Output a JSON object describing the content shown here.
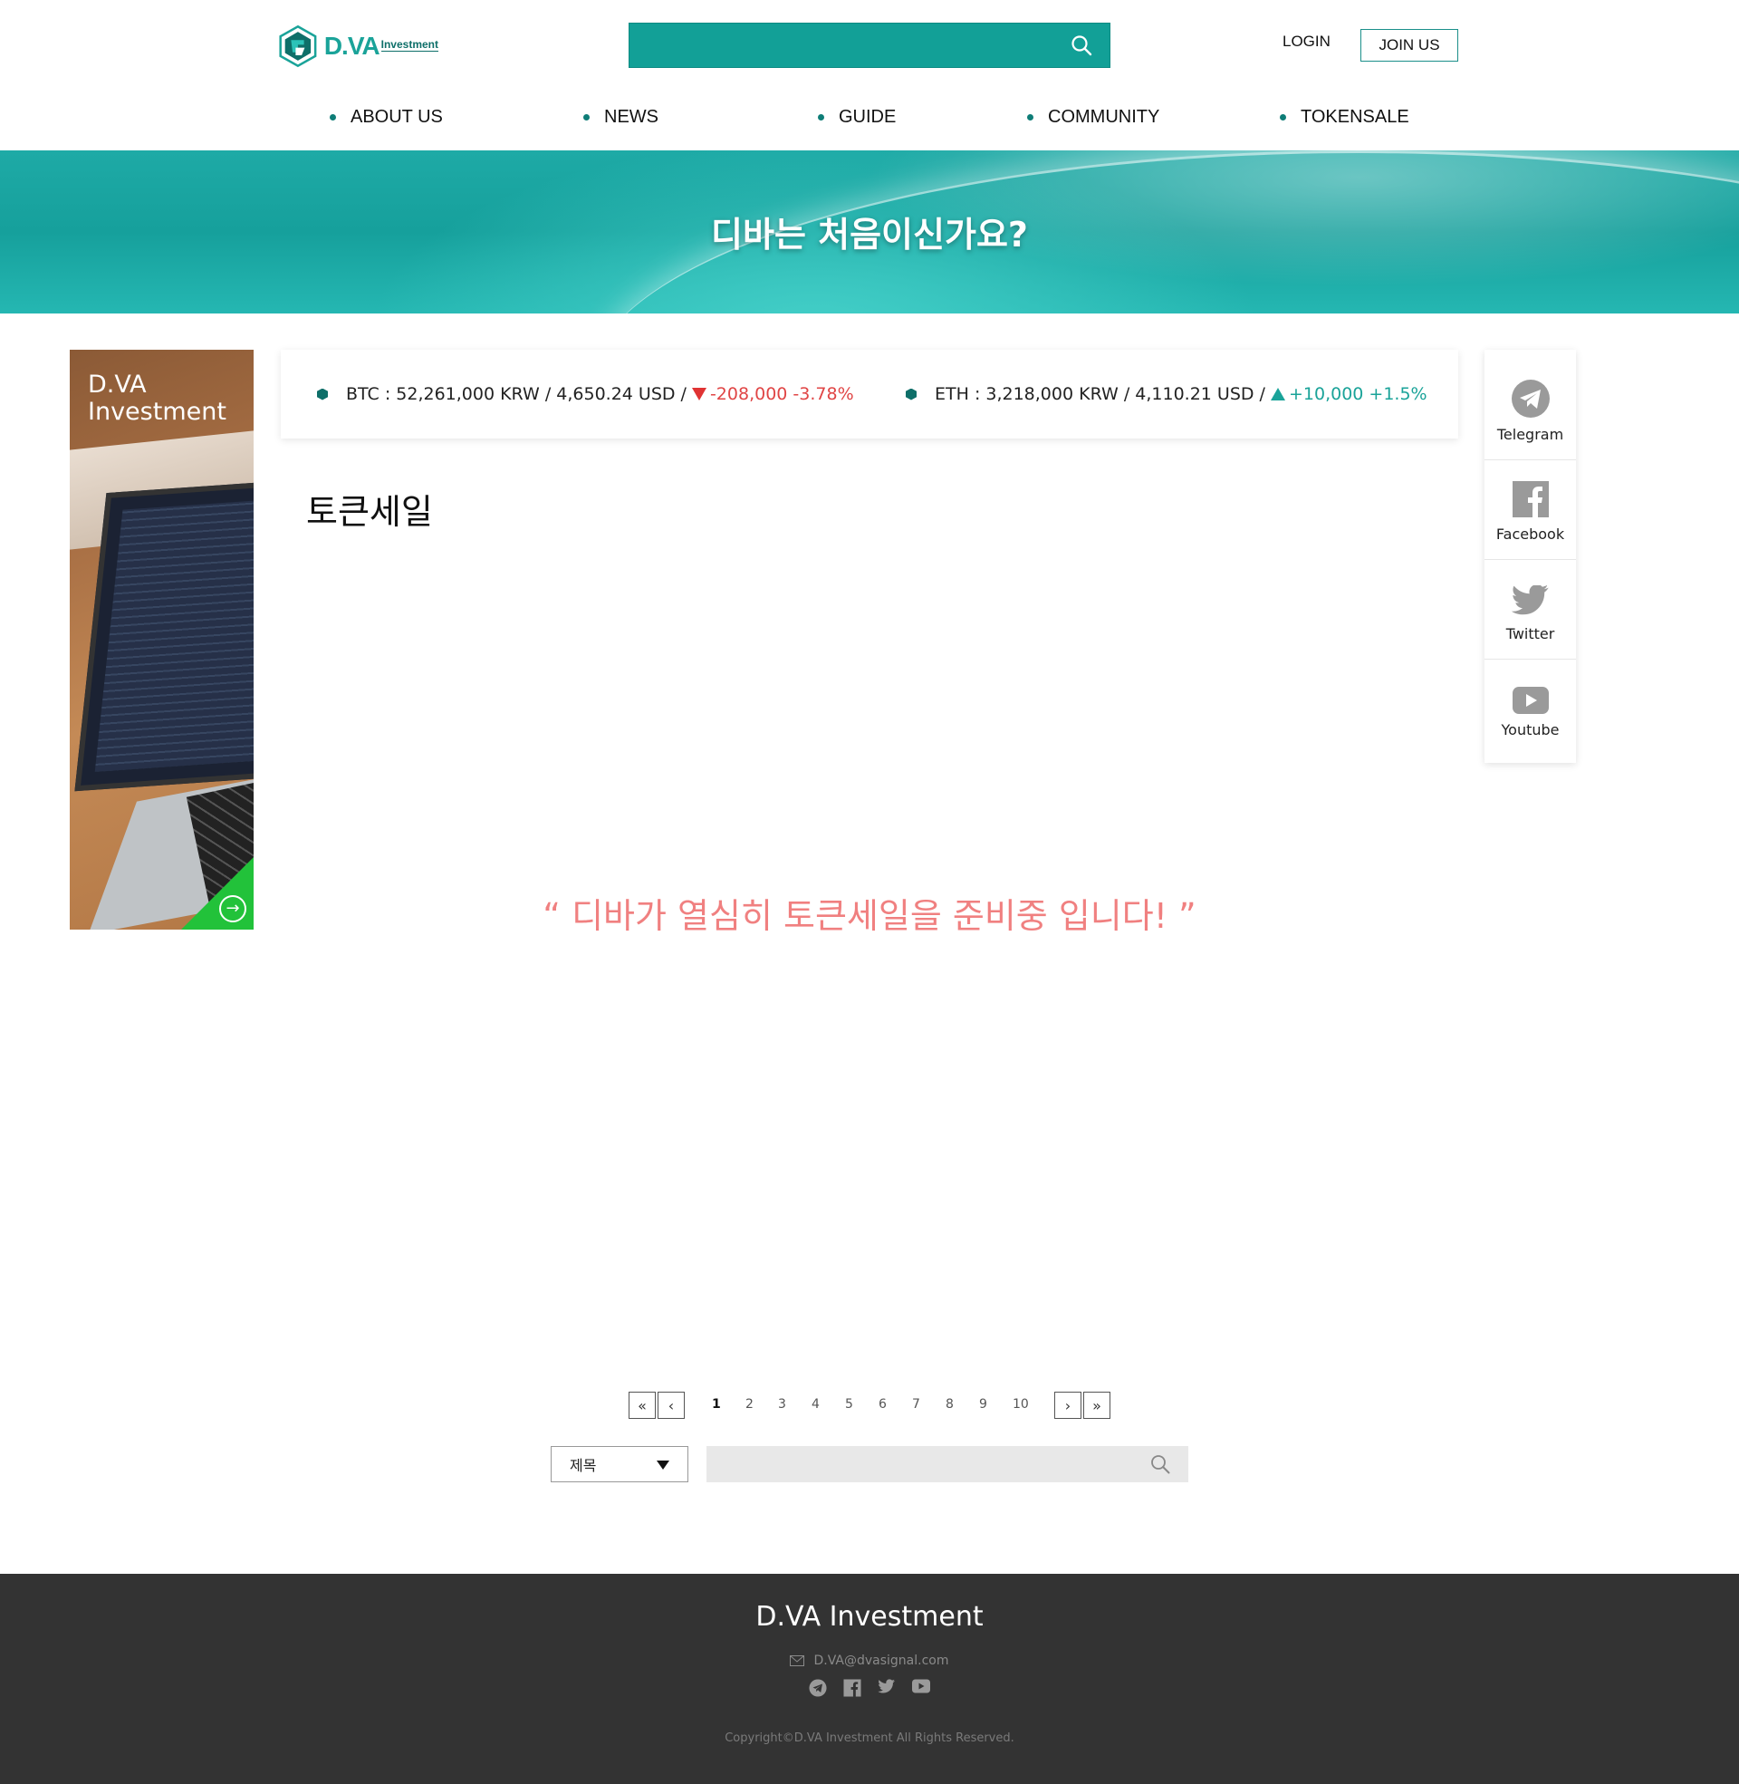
{
  "header": {
    "logo_main": "D.VA",
    "logo_sub": "Investment",
    "search_placeholder": "",
    "login": "LOGIN",
    "joinus": "JOIN US"
  },
  "nav": [
    "ABOUT US",
    "NEWS",
    "GUIDE",
    "COMMUNITY",
    "TOKENSALE"
  ],
  "banner": {
    "title": "디바는 처음이신가요?"
  },
  "ad": {
    "title_line1": "D.VA",
    "title_line2": "Investment",
    "arrow": "→"
  },
  "ticker": {
    "btc": {
      "label": "BTC : 52,261,000 KRW / 4,650.24 USD /",
      "change": "-208,000 -3.78%",
      "direction": "down"
    },
    "eth": {
      "label": "ETH : 3,218,000 KRW / 4,110.21 USD /",
      "change": "+10,000 +1.5%",
      "direction": "up"
    }
  },
  "page": {
    "title": "토큰세일",
    "notice": "“ 디바가 열심히 토큰세일을 준비중 입니다! ”"
  },
  "social": [
    {
      "label": "Telegram",
      "icon": "telegram-icon"
    },
    {
      "label": "Facebook",
      "icon": "facebook-icon"
    },
    {
      "label": "Twitter",
      "icon": "twitter-icon"
    },
    {
      "label": "Youtube",
      "icon": "youtube-icon"
    }
  ],
  "pagination": {
    "first": "«",
    "prev": "‹",
    "next": "›",
    "last": "»",
    "pages": [
      "1",
      "2",
      "3",
      "4",
      "5",
      "6",
      "7",
      "8",
      "9",
      "10"
    ],
    "current": "1"
  },
  "search": {
    "select_value": "제목",
    "placeholder": ""
  },
  "footer": {
    "title": "D.VA Investment",
    "email": "D.VA@dvasignal.com",
    "copyright": "Copyright©D.VA Investment All Rights Reserved."
  },
  "colors": {
    "brand": "#12a097",
    "down": "#e04545",
    "up": "#1aa399",
    "footer_bg": "#333333",
    "ad_green": "#22c23a"
  }
}
